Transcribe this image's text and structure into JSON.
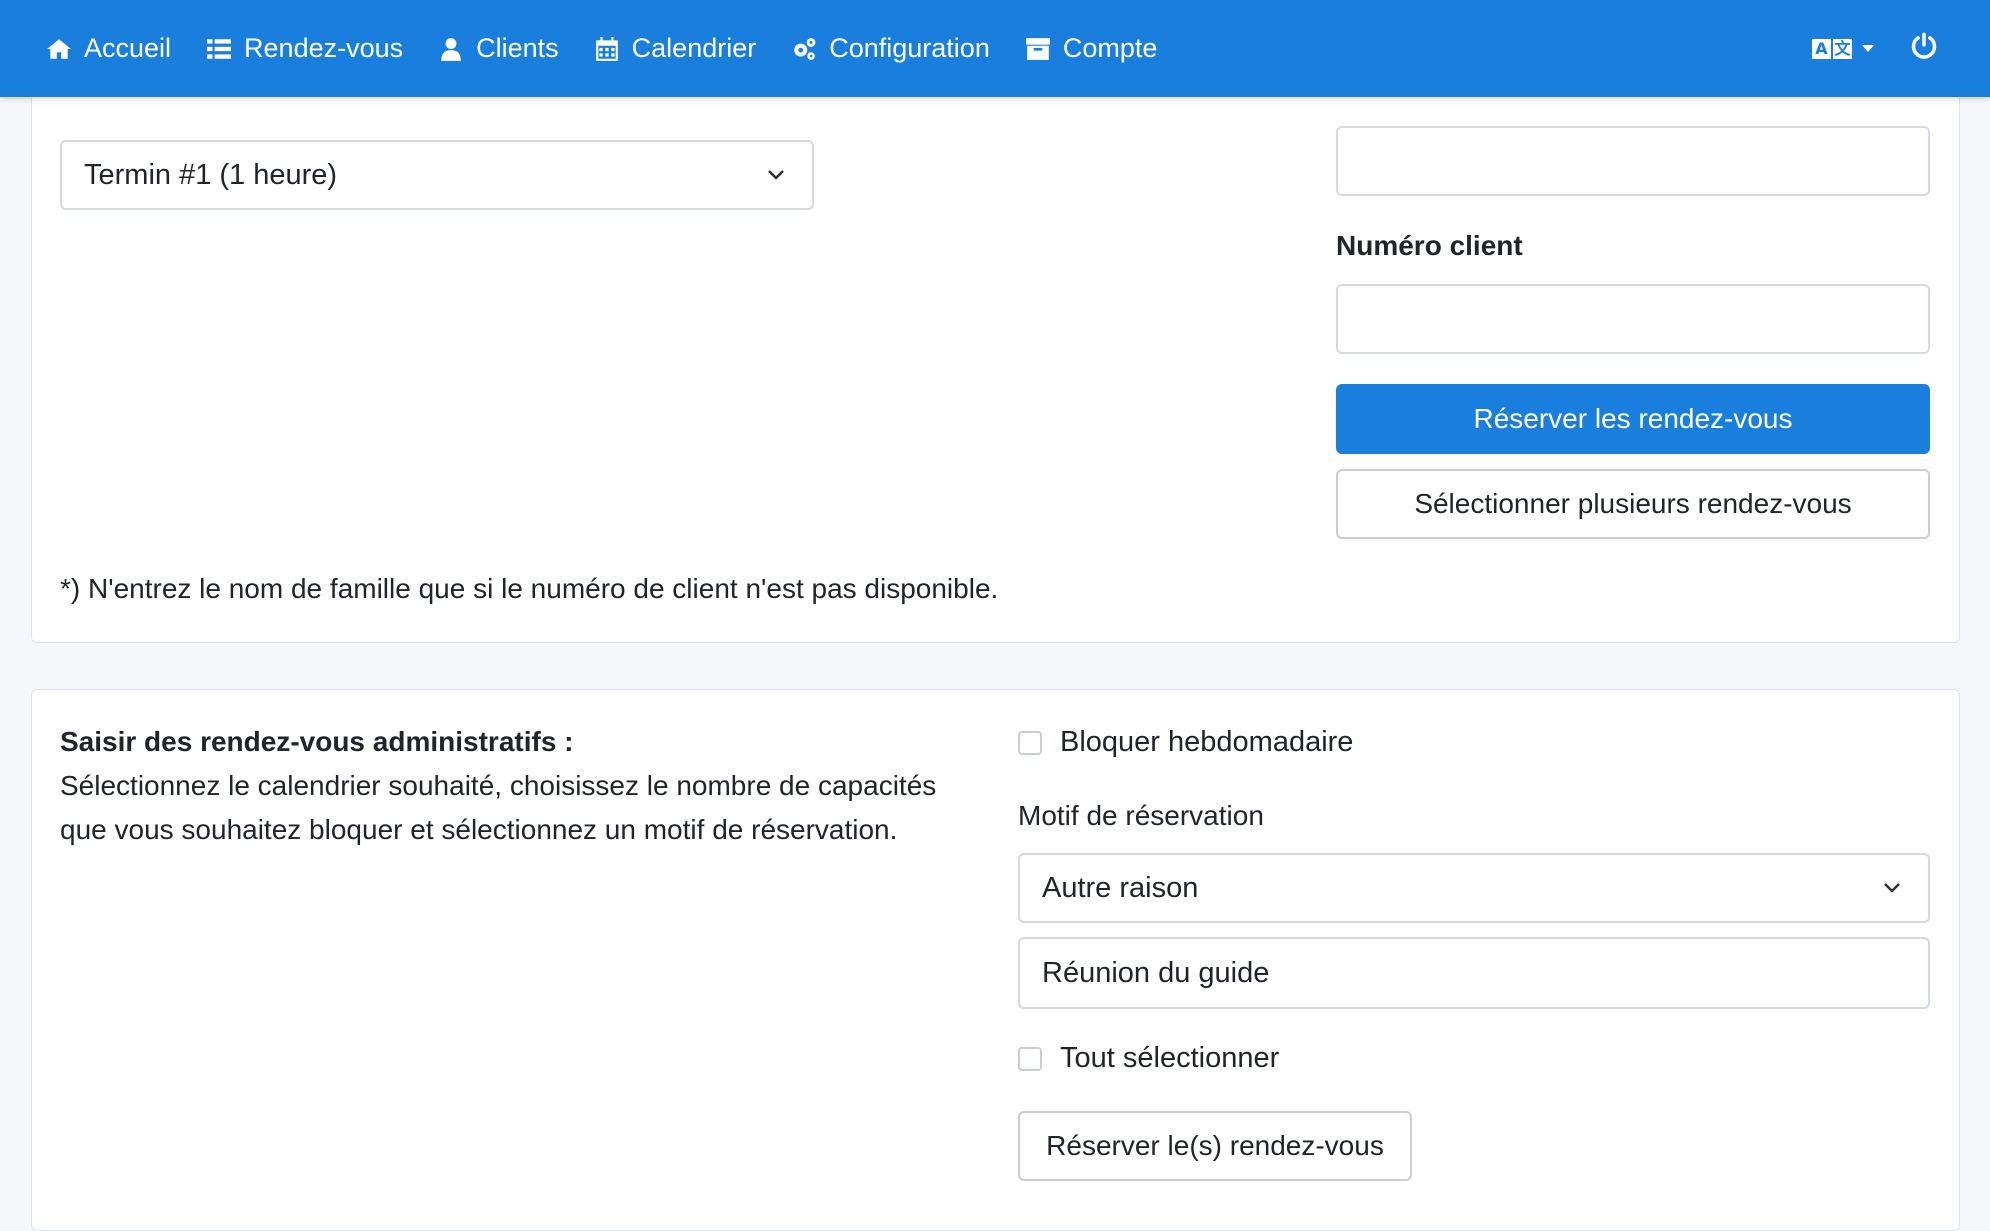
{
  "nav": {
    "items": [
      {
        "label": "Accueil",
        "icon": "home-icon"
      },
      {
        "label": "Rendez-vous",
        "icon": "list-icon"
      },
      {
        "label": "Clients",
        "icon": "user-icon"
      },
      {
        "label": "Calendrier",
        "icon": "calendar-icon"
      },
      {
        "label": "Configuration",
        "icon": "cogs-icon"
      },
      {
        "label": "Compte",
        "icon": "archive-icon"
      }
    ],
    "lang_glyph_a": "A",
    "lang_glyph_b": "文",
    "accent_color": "#1a7fdc"
  },
  "booking": {
    "appointment_select_value": "Termin #1 (1 heure)",
    "top_input_value": "",
    "customer_number_label": "Numéro client",
    "customer_number_value": "",
    "book_button": "Réserver les rendez-vous",
    "multi_select_button": "Sélectionner plusieurs rendez-vous",
    "footnote": "*) N'entrez le nom de famille que si le numéro de client n'est pas disponible."
  },
  "admin": {
    "heading": "Saisir des rendez-vous administratifs :",
    "description": "Sélectionnez le calendrier souhaité, choisissez le nombre de capacités que vous souhaitez bloquer et sélectionnez un motif de réservation.",
    "weekly_block_label": "Bloquer hebdomadaire",
    "reason_label": "Motif de réservation",
    "reason_select_value": "Autre raison",
    "reason_text_value": "Réunion du guide",
    "select_all_label": "Tout sélectionner",
    "book_button": "Réserver le(s) rendez-vous"
  }
}
